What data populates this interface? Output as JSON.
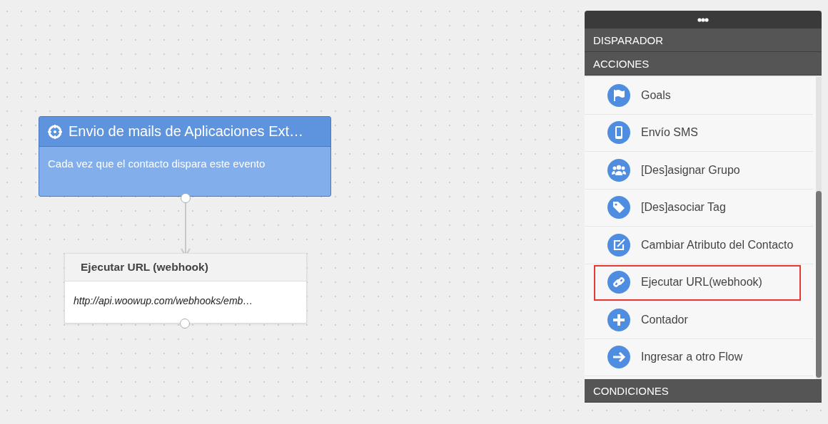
{
  "trigger_node": {
    "title": "Envio de mails de Aplicaciones Ext…",
    "description": "Cada vez que el contacto dispara este evento"
  },
  "action_node": {
    "title": "Ejecutar URL (webhook)",
    "url": "http://api.woowup.com/webhooks/emb…"
  },
  "panel": {
    "sections": [
      "DISPARADOR",
      "ACCIONES"
    ],
    "actions": [
      {
        "label": "Goals",
        "highlighted": false
      },
      {
        "label": "Envío SMS",
        "highlighted": false
      },
      {
        "label": "[Des]asignar Grupo",
        "highlighted": false
      },
      {
        "label": "[Des]asociar Tag",
        "highlighted": false
      },
      {
        "label": "Cambiar Atributo del Contacto",
        "highlighted": false
      },
      {
        "label": "Ejecutar URL(webhook)",
        "highlighted": true
      },
      {
        "label": "Contador",
        "highlighted": false
      },
      {
        "label": "Ingresar a otro Flow",
        "highlighted": false
      }
    ],
    "footer_section": "CONDICIONES"
  }
}
